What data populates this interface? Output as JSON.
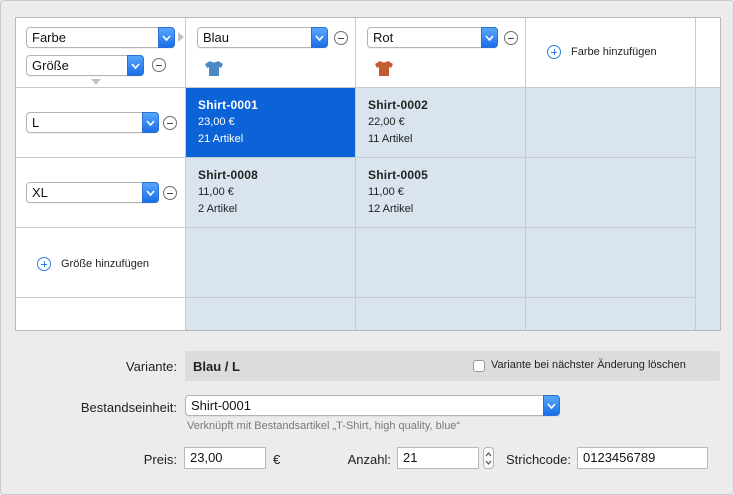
{
  "grid": {
    "header": {
      "attr_color_label": "Farbe",
      "attr_size_label": "Größe",
      "columns": [
        {
          "label": "Blau",
          "shirt_color": "#4a88c6"
        },
        {
          "label": "Rot",
          "shirt_color": "#c35b33"
        }
      ],
      "add_color_label": "Farbe hinzufügen"
    },
    "rows": [
      {
        "label": "L"
      },
      {
        "label": "XL"
      }
    ],
    "add_size_label": "Größe hinzufügen",
    "variants": [
      {
        "id": "Shirt-0001",
        "price": "23,00 €",
        "count": "21 Artikel"
      },
      {
        "id": "Shirt-0002",
        "price": "22,00 €",
        "count": "11 Artikel"
      },
      {
        "id": "Shirt-0008",
        "price": "11,00 €",
        "count": "2 Artikel"
      },
      {
        "id": "Shirt-0005",
        "price": "11,00 €",
        "count": "12 Artikel"
      }
    ]
  },
  "form": {
    "variant_label": "Variante:",
    "variant_value": "Blau / L",
    "delete_checkbox_label": "Variante bei nächster Änderung löschen",
    "stock_unit_label": "Bestandseinheit:",
    "stock_unit_value": "Shirt-0001",
    "stock_unit_hint": "Verknüpft mit Bestandsartikel „T-Shirt, high quality, blue“",
    "price_label": "Preis:",
    "price_value": "23,00",
    "currency": "€",
    "quantity_label": "Anzahl:",
    "quantity_value": "21",
    "barcode_label": "Strichcode:",
    "barcode_value": "0123456789"
  },
  "colors": {
    "selection": "#0c63d8",
    "cell_light": "#dae4ef",
    "accent": "#2f7de0"
  }
}
